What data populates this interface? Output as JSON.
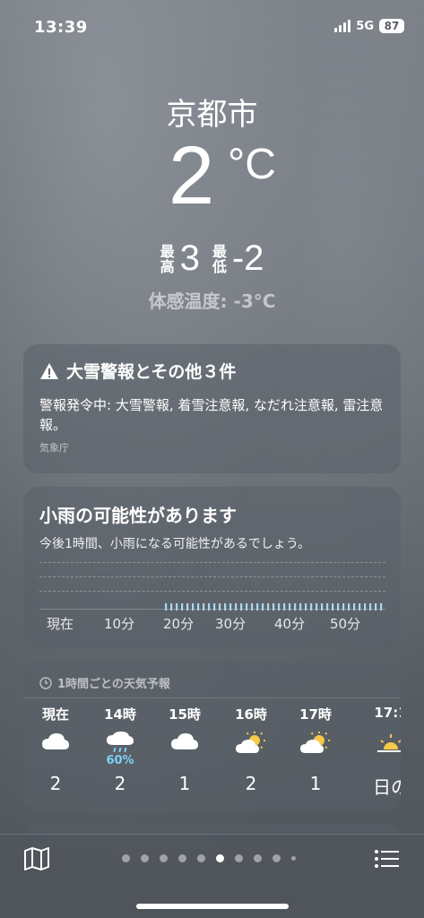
{
  "status": {
    "time": "13:39",
    "network": "5G",
    "battery": "87"
  },
  "header": {
    "city": "京都市",
    "temperature": "2",
    "unit": "°C",
    "high_label_1": "最",
    "high_label_2": "高",
    "high": "3",
    "low_label_1": "最",
    "low_label_2": "低",
    "low": "-2",
    "feels_like": "体感温度: -3°C"
  },
  "alert": {
    "title": "大雪警報とその他３件",
    "body": "警報発令中: 大雪警報, 着雪注意報, なだれ注意報, 雷注意報。",
    "source": "気象庁"
  },
  "precip": {
    "title": "小雨の可能性があります",
    "subtitle": "今後1時間、小雨になる可能性があるでしょう。",
    "chart_data": {
      "type": "bar",
      "x": [
        0,
        60
      ],
      "tick_labels": [
        "現在",
        "10分",
        "20分",
        "30分",
        "40分",
        "50分"
      ],
      "rain_start_minute": 20,
      "intensity": "light",
      "color": "#a8d8f5"
    }
  },
  "hourly": {
    "heading": "1時間ごとの天気予報",
    "hours": [
      {
        "label": "現在",
        "icon": "cloud-icon",
        "pop": "",
        "temp": "2"
      },
      {
        "label": "14時",
        "icon": "cloud-rain-icon",
        "pop": "60%",
        "temp": "2"
      },
      {
        "label": "15時",
        "icon": "cloud-icon",
        "pop": "",
        "temp": "1"
      },
      {
        "label": "16時",
        "icon": "partly-sunny-icon",
        "pop": "",
        "temp": "2"
      },
      {
        "label": "17時",
        "icon": "partly-sunny-icon",
        "pop": "",
        "temp": "1"
      },
      {
        "label": "17:1",
        "icon": "sunset-icon",
        "pop": "",
        "temp": "日の"
      }
    ]
  },
  "pager": {
    "count": 10,
    "active_index": 5
  },
  "colors": {
    "accent_rain": "#7fd0f8",
    "sun": "#f7c948"
  }
}
